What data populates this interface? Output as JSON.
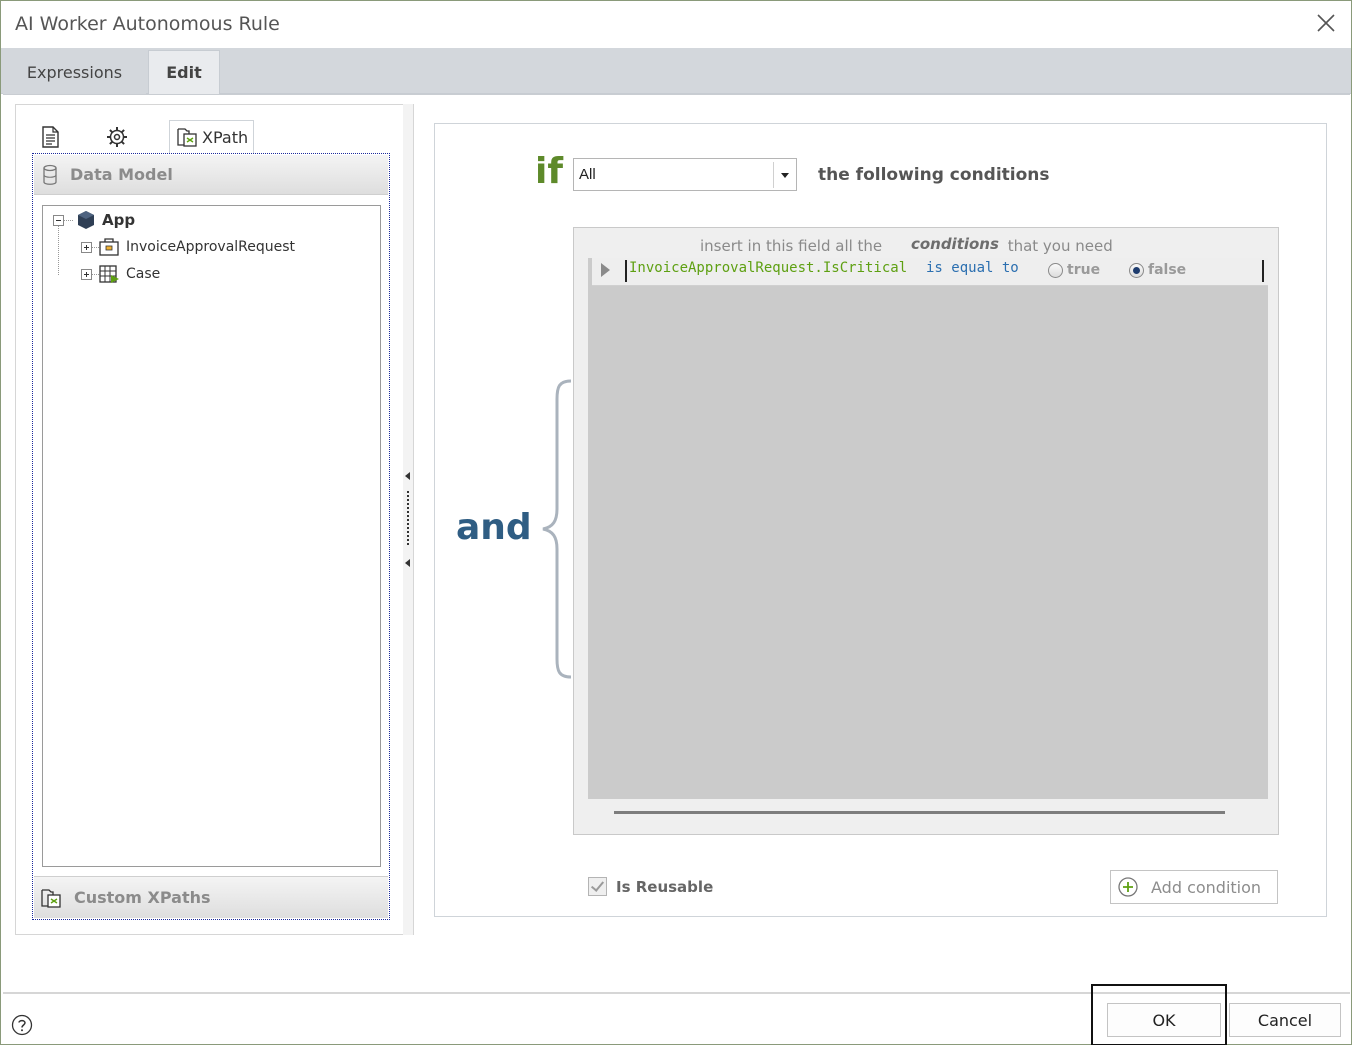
{
  "window": {
    "title": "AI Worker Autonomous Rule"
  },
  "tabs": [
    {
      "label": "Expressions",
      "active": false
    },
    {
      "label": "Edit",
      "active": true
    }
  ],
  "left_panel": {
    "toolbar": {
      "icons": [
        "document-icon",
        "gear-icon",
        "xpath-icon"
      ],
      "xpath_tab_label": "XPath"
    },
    "data_model": {
      "header": "Data Model",
      "tree": {
        "root": "App",
        "children": [
          "InvoiceApprovalRequest",
          "Case"
        ]
      }
    },
    "custom_xpaths": {
      "header": "Custom XPaths"
    }
  },
  "rule": {
    "if_word": "if",
    "quantifier": "All",
    "following": "the following conditions",
    "and_word": "and",
    "hint": {
      "before": "insert in this field all the ",
      "emphasis": "conditions",
      "after": " that you need"
    },
    "conditions": [
      {
        "field": "InvoiceApprovalRequest.IsCritical",
        "operator": "is equal to",
        "options": [
          "true",
          "false"
        ],
        "selected": "false"
      }
    ],
    "is_reusable_label": "Is Reusable",
    "is_reusable": true,
    "add_condition_label": "Add condition"
  },
  "footer": {
    "ok_label": "OK",
    "cancel_label": "Cancel",
    "help_icon": "question-circle-icon"
  },
  "colors": {
    "if_green": "#5e8a2a",
    "and_blue": "#2f5d83",
    "field_green": "#5ea012",
    "operator_blue": "#2b6fb0",
    "tab_strip": "#d3d7dc",
    "condition_area": "#cbcbcb"
  }
}
